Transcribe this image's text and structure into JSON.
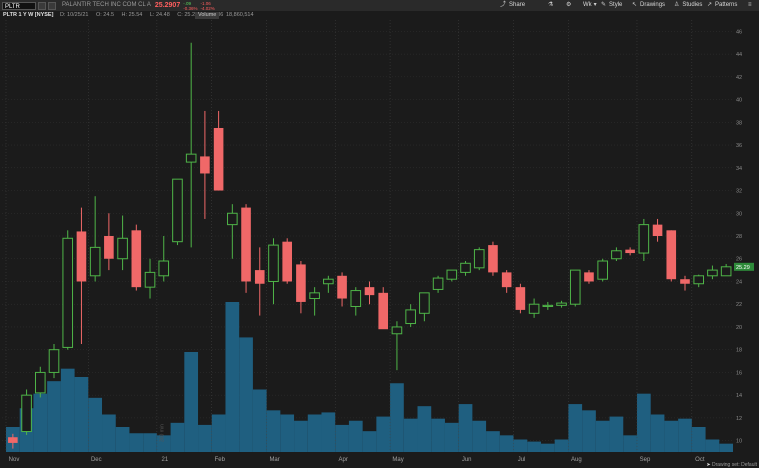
{
  "toolbar": {
    "symbol": "PLTR",
    "company": "PALANTIR TECH INC COM CL A",
    "price": "25.2907",
    "change_top": "-.09",
    "change_bottom": "-0.36%",
    "change_extra1": "-1.06",
    "change_extra2": "-4.02%",
    "share_label": "Share",
    "period_label": "Wk",
    "style_label": "Style",
    "drawings_label": "Drawings",
    "studies_label": "Studies",
    "patterns_label": "Patterns"
  },
  "header": {
    "chart_label": "PLTR 1 Y W [NYSE]",
    "date": "D: 10/25/21",
    "open": "O: 24.5",
    "high": "H: 25.54",
    "low": "L: 24.48",
    "close": "C: 25.29",
    "range": "R: 1.06",
    "volume_label": "Volume",
    "volume_value": "18,860,514"
  },
  "footer": {
    "drawing_set": "Drawing set: Default"
  },
  "colors": {
    "up": "#4fb548",
    "down": "#f06868",
    "volume": "#1f5f80",
    "background": "#1b1b1b",
    "grid": "#333333",
    "current_price_tag": "#2e8b3a"
  },
  "chart_data": {
    "type": "candlestick",
    "y_range": [
      9,
      47
    ],
    "y_ticks": [
      10,
      12,
      14,
      16,
      18,
      20,
      22,
      24,
      26,
      28,
      30,
      32,
      34,
      36,
      38,
      40,
      42,
      44,
      46
    ],
    "x_labels": [
      "Nov",
      "Dec",
      "21",
      "Feb",
      "Mar",
      "Apr",
      "May",
      "Jun",
      "Jul",
      "Aug",
      "Sep",
      "Oct"
    ],
    "x_label_index": [
      0,
      6,
      11,
      15,
      19,
      24,
      28,
      33,
      37,
      41,
      46,
      50
    ],
    "current_price_label": "25.29",
    "candles": [
      {
        "o": 10.3,
        "h": 10.6,
        "l": 9.3,
        "c": 9.8
      },
      {
        "o": 10.8,
        "h": 14.5,
        "l": 10.5,
        "c": 14.0
      },
      {
        "o": 14.2,
        "h": 16.5,
        "l": 13.8,
        "c": 16.0
      },
      {
        "o": 16.0,
        "h": 18.5,
        "l": 15.5,
        "c": 18.0
      },
      {
        "o": 18.2,
        "h": 28.5,
        "l": 18.0,
        "c": 27.8
      },
      {
        "o": 28.4,
        "h": 30.5,
        "l": 18.5,
        "c": 24.0
      },
      {
        "o": 24.5,
        "h": 31.5,
        "l": 24.0,
        "c": 27.0
      },
      {
        "o": 28.0,
        "h": 30.0,
        "l": 25.0,
        "c": 26.0
      },
      {
        "o": 26.0,
        "h": 29.8,
        "l": 25.0,
        "c": 27.8
      },
      {
        "o": 28.5,
        "h": 29.0,
        "l": 23.2,
        "c": 23.5
      },
      {
        "o": 23.5,
        "h": 26.0,
        "l": 22.5,
        "c": 24.8
      },
      {
        "o": 24.5,
        "h": 28.0,
        "l": 24.0,
        "c": 25.8
      },
      {
        "o": 27.5,
        "h": 33.0,
        "l": 27.2,
        "c": 33.0
      },
      {
        "o": 34.5,
        "h": 45.0,
        "l": 27.0,
        "c": 35.2
      },
      {
        "o": 35.0,
        "h": 39.0,
        "l": 29.5,
        "c": 33.5
      },
      {
        "o": 37.5,
        "h": 39.0,
        "l": 32.0,
        "c": 32.0
      },
      {
        "o": 29.0,
        "h": 30.8,
        "l": 26.0,
        "c": 30.0
      },
      {
        "o": 30.5,
        "h": 30.8,
        "l": 23.0,
        "c": 24.0
      },
      {
        "o": 25.0,
        "h": 27.0,
        "l": 21.0,
        "c": 23.8
      },
      {
        "o": 24.0,
        "h": 27.8,
        "l": 22.0,
        "c": 27.2
      },
      {
        "o": 27.5,
        "h": 27.8,
        "l": 23.8,
        "c": 24.0
      },
      {
        "o": 25.5,
        "h": 25.8,
        "l": 21.2,
        "c": 22.2
      },
      {
        "o": 22.5,
        "h": 23.5,
        "l": 21.0,
        "c": 23.0
      },
      {
        "o": 23.8,
        "h": 24.5,
        "l": 23.0,
        "c": 24.2
      },
      {
        "o": 24.5,
        "h": 24.8,
        "l": 21.8,
        "c": 22.5
      },
      {
        "o": 21.8,
        "h": 23.5,
        "l": 21.0,
        "c": 23.2
      },
      {
        "o": 23.5,
        "h": 24.0,
        "l": 22.0,
        "c": 22.8
      },
      {
        "o": 23.0,
        "h": 23.5,
        "l": 20.2,
        "c": 19.8
      },
      {
        "o": 19.4,
        "h": 20.5,
        "l": 16.2,
        "c": 20.0
      },
      {
        "o": 20.3,
        "h": 22.0,
        "l": 20.0,
        "c": 21.5
      },
      {
        "o": 21.2,
        "h": 23.0,
        "l": 20.5,
        "c": 23.0
      },
      {
        "o": 23.3,
        "h": 24.5,
        "l": 23.0,
        "c": 24.3
      },
      {
        "o": 24.2,
        "h": 25.0,
        "l": 24.0,
        "c": 25.0
      },
      {
        "o": 24.8,
        "h": 25.8,
        "l": 24.5,
        "c": 25.6
      },
      {
        "o": 25.2,
        "h": 27.0,
        "l": 25.0,
        "c": 26.8
      },
      {
        "o": 27.2,
        "h": 27.5,
        "l": 24.5,
        "c": 24.8
      },
      {
        "o": 24.8,
        "h": 25.0,
        "l": 23.0,
        "c": 23.5
      },
      {
        "o": 23.5,
        "h": 23.8,
        "l": 21.2,
        "c": 21.5
      },
      {
        "o": 21.2,
        "h": 22.5,
        "l": 20.8,
        "c": 22.0
      },
      {
        "o": 21.8,
        "h": 22.2,
        "l": 21.5,
        "c": 21.9
      },
      {
        "o": 21.9,
        "h": 22.3,
        "l": 21.7,
        "c": 22.1
      },
      {
        "o": 22.0,
        "h": 25.0,
        "l": 21.8,
        "c": 25.0
      },
      {
        "o": 24.8,
        "h": 25.0,
        "l": 23.8,
        "c": 24.0
      },
      {
        "o": 24.2,
        "h": 26.0,
        "l": 24.0,
        "c": 25.8
      },
      {
        "o": 26.0,
        "h": 27.0,
        "l": 25.8,
        "c": 26.7
      },
      {
        "o": 26.8,
        "h": 27.0,
        "l": 26.3,
        "c": 26.5
      },
      {
        "o": 26.5,
        "h": 29.5,
        "l": 25.8,
        "c": 29.0
      },
      {
        "o": 29.0,
        "h": 29.5,
        "l": 27.5,
        "c": 28.0
      },
      {
        "o": 28.5,
        "h": 28.5,
        "l": 24.0,
        "c": 24.2
      },
      {
        "o": 24.2,
        "h": 24.5,
        "l": 23.2,
        "c": 23.8
      },
      {
        "o": 23.8,
        "h": 24.6,
        "l": 23.5,
        "c": 24.5
      },
      {
        "o": 24.5,
        "h": 25.4,
        "l": 24.2,
        "c": 25.0
      },
      {
        "o": 24.5,
        "h": 25.54,
        "l": 24.48,
        "c": 25.29
      }
    ],
    "volume_relative": [
      0.12,
      0.21,
      0.28,
      0.34,
      0.4,
      0.36,
      0.26,
      0.18,
      0.12,
      0.09,
      0.09,
      0.08,
      0.14,
      0.48,
      0.13,
      0.18,
      0.72,
      0.55,
      0.3,
      0.2,
      0.18,
      0.15,
      0.18,
      0.19,
      0.13,
      0.15,
      0.1,
      0.17,
      0.33,
      0.16,
      0.22,
      0.16,
      0.14,
      0.23,
      0.15,
      0.1,
      0.08,
      0.06,
      0.05,
      0.04,
      0.06,
      0.23,
      0.2,
      0.15,
      0.17,
      0.08,
      0.28,
      0.18,
      0.15,
      0.16,
      0.12,
      0.06,
      0.04
    ],
    "volume_annotation": "300 min",
    "ylabel": "",
    "xlabel": ""
  }
}
